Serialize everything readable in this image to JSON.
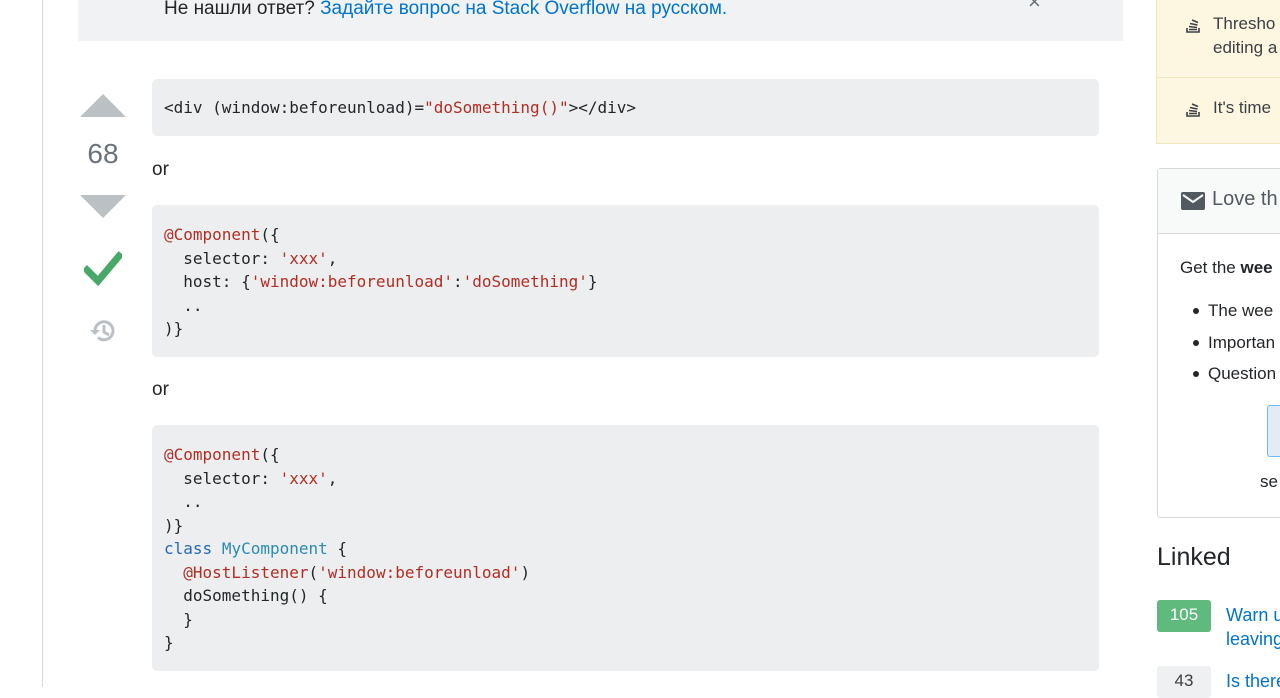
{
  "banner": {
    "prefix": "Не нашли ответ?",
    "link": "Задайте вопрос на Stack Overflow на русском.",
    "close_glyph": "×"
  },
  "answer": {
    "score": "68",
    "connector_1": "or",
    "connector_2": "or"
  },
  "code_blocks": [
    {
      "lines": [
        [
          [
            "plain",
            "<div (window:beforeunload)="
          ],
          [
            "str",
            "\"doSomething()\""
          ],
          [
            "plain",
            "></div>"
          ]
        ]
      ]
    },
    {
      "lines": [
        [
          [
            "ann",
            "@Component"
          ],
          [
            "plain",
            "({"
          ]
        ],
        [
          [
            "plain",
            "  selector: "
          ],
          [
            "str",
            "'xxx'"
          ],
          [
            "plain",
            ","
          ]
        ],
        [
          [
            "plain",
            "  host: {"
          ],
          [
            "str",
            "'window:beforeunload'"
          ],
          [
            "plain",
            ":"
          ],
          [
            "str",
            "'doSomething'"
          ],
          [
            "plain",
            "}"
          ]
        ],
        [
          [
            "plain",
            "  .."
          ]
        ],
        [
          [
            "plain",
            ")}"
          ]
        ]
      ]
    },
    {
      "lines": [
        [
          [
            "ann",
            "@Component"
          ],
          [
            "plain",
            "({"
          ]
        ],
        [
          [
            "plain",
            "  selector: "
          ],
          [
            "str",
            "'xxx'"
          ],
          [
            "plain",
            ","
          ]
        ],
        [
          [
            "plain",
            "  .."
          ]
        ],
        [
          [
            "plain",
            ")}"
          ]
        ],
        [
          [
            "kw",
            "class"
          ],
          [
            "plain",
            " "
          ],
          [
            "type",
            "MyComponent"
          ],
          [
            "plain",
            " {"
          ]
        ],
        [
          [
            "plain",
            "  "
          ],
          [
            "ann",
            "@HostListener"
          ],
          [
            "plain",
            "("
          ],
          [
            "str",
            "'window:beforeunload'"
          ],
          [
            "plain",
            ")"
          ]
        ],
        [
          [
            "plain",
            "  doSomething() {"
          ]
        ],
        [
          [
            "plain",
            "  }"
          ]
        ],
        [
          [
            "plain",
            "}"
          ]
        ]
      ]
    }
  ],
  "sidebar": {
    "meta_items": [
      {
        "label": "Thresho",
        "label2": "editing a",
        "icon": "stack-icon"
      },
      {
        "label": "It's time",
        "icon": "stack-icon"
      }
    ],
    "newsletter": {
      "title": "Love th",
      "intro_prefix": "Get the ",
      "intro_bold": "wee",
      "bullets": [
        "The wee",
        "Importan",
        "Question"
      ],
      "footer": "se"
    },
    "linked_title": "Linked",
    "linked": [
      {
        "score": "105",
        "accepted": true,
        "title": "Warn u",
        "title2": "leaving"
      },
      {
        "score": "43",
        "accepted": false,
        "title": "Is there"
      }
    ]
  },
  "colors": {
    "accent_link": "#0074cc",
    "accepted_green": "#48a868",
    "code_bg": "#eceef0",
    "string": "#b12e24",
    "keyword": "#2767b8"
  }
}
